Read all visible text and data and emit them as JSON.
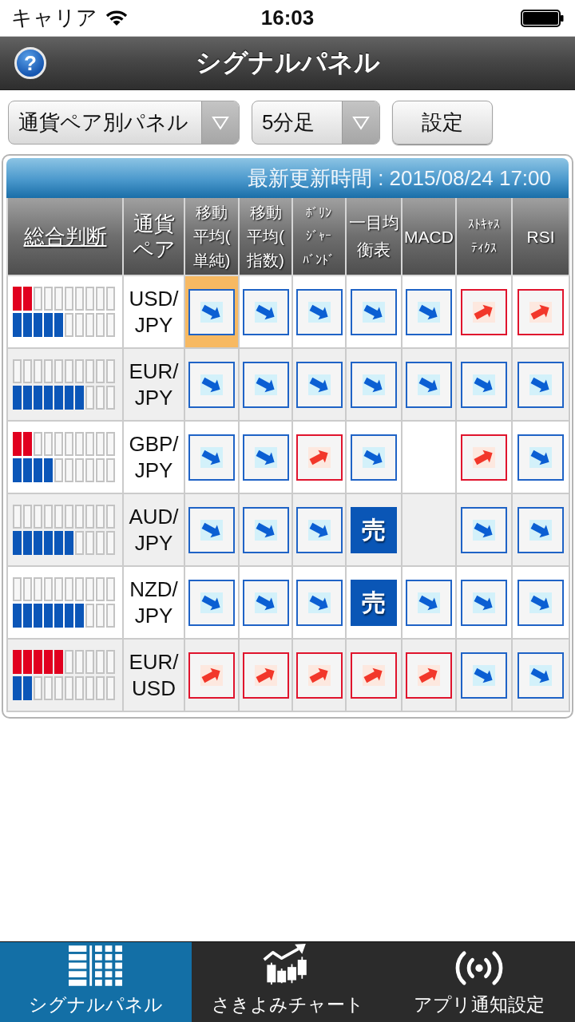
{
  "status_bar": {
    "carrier": "キャリア",
    "time": "16:03"
  },
  "nav_bar": {
    "help_button": "?",
    "title": "シグナルパネル"
  },
  "controls": {
    "dropdowns": [
      {
        "value": "通貨ペア別パネル"
      },
      {
        "value": "5分足"
      }
    ],
    "settings_button": "設定"
  },
  "panel": {
    "updated": "最新更新時間 : 2015/08/24 17:00",
    "columns": [
      {
        "label": "総合判断",
        "link": true
      },
      {
        "label": "通貨ペア",
        "link": false
      },
      {
        "label": "移動平均(単純)",
        "link": false
      },
      {
        "label": "移動平均(指数)",
        "link": false
      },
      {
        "label": "ﾎﾞﾘﾝｼﾞｬｰﾊﾞﾝﾄﾞ",
        "link": false
      },
      {
        "label": "一目均衡表",
        "link": false
      },
      {
        "label": "MACD",
        "link": false
      },
      {
        "label": "ｽﾄｷｬｽﾃｨｸｽ",
        "link": false
      },
      {
        "label": "RSI",
        "link": false
      }
    ],
    "rows": [
      {
        "pair": "USD/JPY",
        "buy_meter": {
          "level": 0.2
        },
        "sell_meter": {
          "level": 0.5
        },
        "signals": [
          {
            "kind": "down",
            "selected": true
          },
          {
            "kind": "down",
            "selected": false
          },
          {
            "kind": "down",
            "selected": false
          },
          {
            "kind": "down",
            "selected": false
          },
          {
            "kind": "down",
            "selected": false
          },
          {
            "kind": "up",
            "selected": false
          },
          {
            "kind": "up",
            "selected": false
          }
        ]
      },
      {
        "pair": "EUR/JPY",
        "buy_meter": {
          "level": 0
        },
        "sell_meter": {
          "level": 0.7
        },
        "signals": [
          {
            "kind": "down",
            "selected": false
          },
          {
            "kind": "down",
            "selected": false
          },
          {
            "kind": "down",
            "selected": false
          },
          {
            "kind": "down",
            "selected": false
          },
          {
            "kind": "down",
            "selected": false
          },
          {
            "kind": "down",
            "selected": false
          },
          {
            "kind": "down",
            "selected": false
          }
        ]
      },
      {
        "pair": "GBP/JPY",
        "buy_meter": {
          "level": 0.2
        },
        "sell_meter": {
          "level": 0.4
        },
        "signals": [
          {
            "kind": "down",
            "selected": false
          },
          {
            "kind": "down",
            "selected": false
          },
          {
            "kind": "up",
            "selected": false
          },
          {
            "kind": "down",
            "selected": false
          },
          {
            "kind": "none",
            "selected": false
          },
          {
            "kind": "up",
            "selected": false
          },
          {
            "kind": "down",
            "selected": false
          }
        ]
      },
      {
        "pair": "AUD/JPY",
        "buy_meter": {
          "level": 0
        },
        "sell_meter": {
          "level": 0.6
        },
        "signals": [
          {
            "kind": "down",
            "selected": false
          },
          {
            "kind": "down",
            "selected": false
          },
          {
            "kind": "down",
            "selected": false
          },
          {
            "kind": "sell",
            "label": "売",
            "selected": false
          },
          {
            "kind": "none",
            "selected": false
          },
          {
            "kind": "down",
            "selected": false
          },
          {
            "kind": "down",
            "selected": false
          }
        ]
      },
      {
        "pair": "NZD/JPY",
        "buy_meter": {
          "level": 0
        },
        "sell_meter": {
          "level": 0.7
        },
        "signals": [
          {
            "kind": "down",
            "selected": false
          },
          {
            "kind": "down",
            "selected": false
          },
          {
            "kind": "down",
            "selected": false
          },
          {
            "kind": "sell",
            "label": "売",
            "selected": false
          },
          {
            "kind": "down",
            "selected": false
          },
          {
            "kind": "down",
            "selected": false
          },
          {
            "kind": "down",
            "selected": false
          }
        ]
      },
      {
        "pair": "EUR/USD",
        "buy_meter": {
          "level": 0.5
        },
        "sell_meter": {
          "level": 0.2
        },
        "signals": [
          {
            "kind": "up",
            "selected": false
          },
          {
            "kind": "up",
            "selected": false
          },
          {
            "kind": "up",
            "selected": false
          },
          {
            "kind": "up",
            "selected": false
          },
          {
            "kind": "up",
            "selected": false
          },
          {
            "kind": "down",
            "selected": false
          },
          {
            "kind": "down",
            "selected": false
          }
        ]
      }
    ]
  },
  "tab_bar": [
    {
      "label": "シグナルパネル",
      "selected": true
    },
    {
      "label": "さきよみチャート",
      "selected": false
    },
    {
      "label": "アプリ通知設定",
      "selected": false
    }
  ]
}
